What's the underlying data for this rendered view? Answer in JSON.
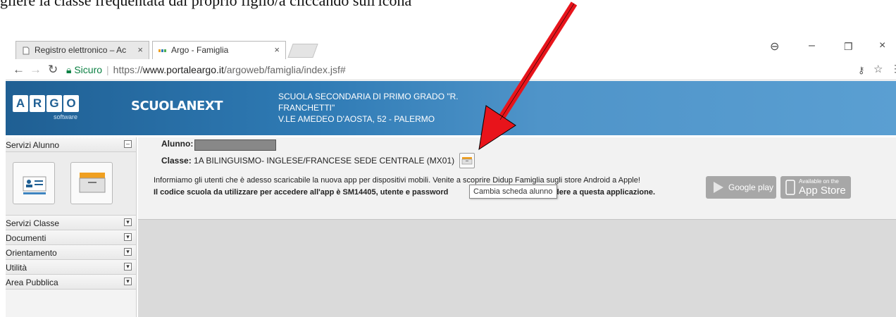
{
  "caption": "gliere la classe frequentata dal proprio figlio/a cliccando sull'icona",
  "browser": {
    "tabs": [
      {
        "label": "Registro elettronico – Ac",
        "active": false
      },
      {
        "label": "Argo - Famiglia",
        "active": true
      }
    ],
    "secure_label": "Sicuro",
    "url_scheme": "https://",
    "url_host": "www.portaleargo.it",
    "url_path": "/argoweb/famiglia/index.jsf#"
  },
  "header": {
    "logo_letters": [
      "A",
      "R",
      "G",
      "O"
    ],
    "logo_sub": "software",
    "product": "SCUOLANEXT",
    "school_line1": "SCUOLA SECONDARIA DI PRIMO GRADO \"R.",
    "school_line2": "FRANCHETTI\"",
    "school_line3": "V.LE AMEDEO D'AOSTA, 52 - PALERMO"
  },
  "sidebar": {
    "first": "Servizi Alunno",
    "items": [
      "Servizi Classe",
      "Documenti",
      "Orientamento",
      "Utilità",
      "Area Pubblica"
    ]
  },
  "main": {
    "alunno_label": "Alunno:",
    "classe_label": "Classe:",
    "classe_value": "1A BILINGUISMO- INGLESE/FRANCESE SEDE CENTRALE (MX01)",
    "msg1": "Informiamo gli utenti che è adesso scaricabile la nuova app per dispositivi mobili. Venite a scoprire Didup Famiglia sugli store Android a Apple!",
    "msg2a": "Il codice scuola da utilizzare per accedere all'app è SM14405, utente e password",
    "msg2b": "per accedere a questa applicazione.",
    "tooltip": "Cambia scheda alunno",
    "gplay_small": "",
    "gplay_big": "Google play",
    "appstore_small": "Available on the",
    "appstore_big": "App Store"
  },
  "colors": {
    "accent": "#1f5f93",
    "arrow": "#e8141b"
  }
}
